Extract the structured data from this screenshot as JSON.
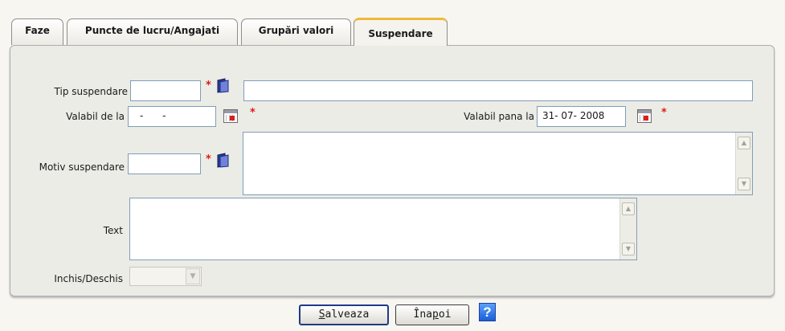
{
  "tabs": [
    {
      "label": "Faze"
    },
    {
      "label": "Puncte de lucru/Angajati"
    },
    {
      "label": "Grupări valori"
    },
    {
      "label": "Suspendare",
      "active": true
    }
  ],
  "form": {
    "tip_suspendare_label": "Tip suspendare",
    "tip_suspendare_code": "",
    "tip_suspendare_desc": "",
    "valabil_de_la_label": "Valabil de la",
    "valabil_de_la_value": "- -",
    "valabil_pana_la_label": "Valabil pana la",
    "valabil_pana_la_value": "31- 07- 2008",
    "motiv_suspendare_label": "Motiv suspendare",
    "motiv_suspendare_code": "",
    "motiv_suspendare_text": "",
    "text_label": "Text",
    "text_value": "",
    "inchis_deschis_label": "Inchis/Deschis",
    "inchis_deschis_value": "",
    "required_mark": "*"
  },
  "buttons": {
    "save_underline": "S",
    "save_rest": "alveaza",
    "back_pre": "Îna",
    "back_underline": "p",
    "back_post": "oi",
    "help": "?"
  },
  "colors": {
    "tab_active_accent": "#f0b83c",
    "required": "#e01919",
    "help_blue": "#1a5fd6"
  },
  "icons": {
    "lookup": "folder-icon",
    "calendar": "calendar-icon",
    "help": "help-icon"
  }
}
